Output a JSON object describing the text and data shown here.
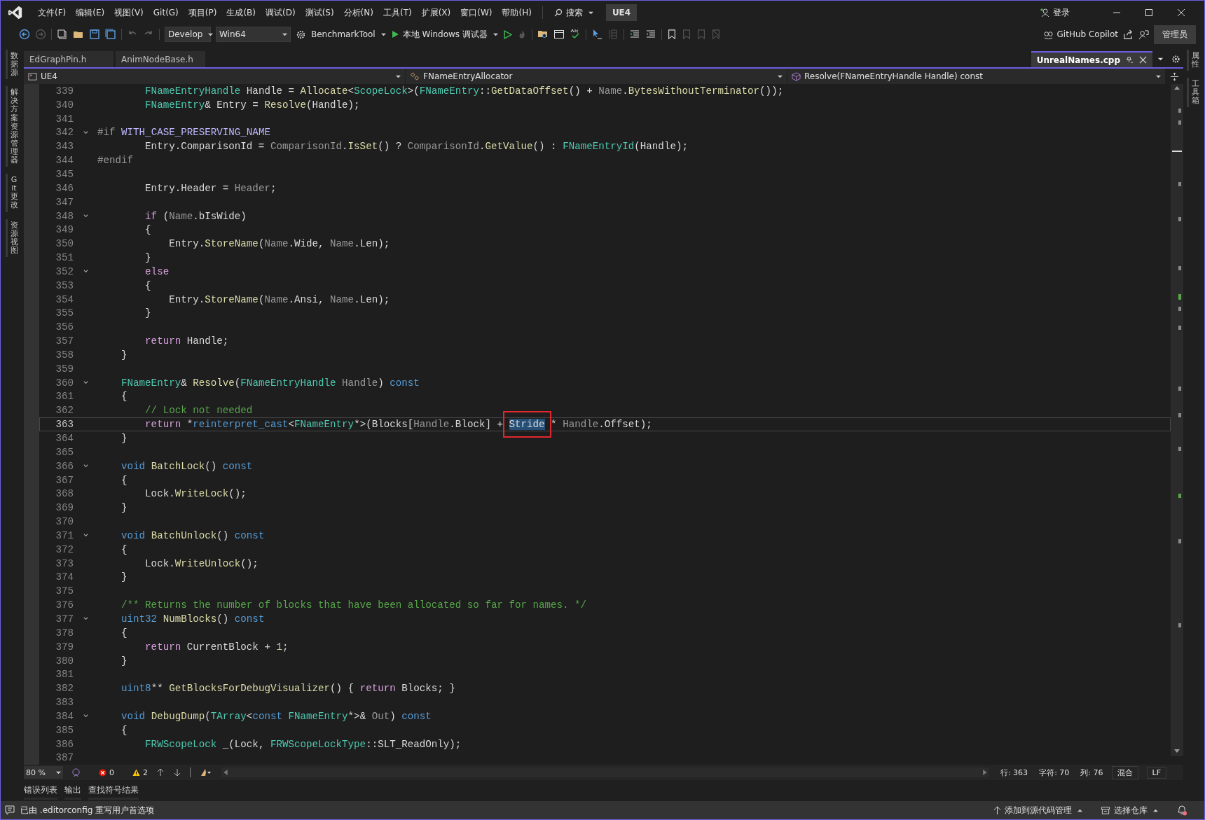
{
  "title_bar": {
    "menu": [
      "文件(F)",
      "编辑(E)",
      "视图(V)",
      "Git(G)",
      "项目(P)",
      "生成(B)",
      "调试(D)",
      "测试(S)",
      "分析(N)",
      "工具(T)",
      "扩展(X)",
      "窗口(W)",
      "帮助(H)"
    ],
    "search": "搜索",
    "solution": "UE4",
    "sign_in": "登录"
  },
  "toolbar": {
    "configuration": "Develop",
    "platform": "Win64",
    "startup_project": "BenchmarkTool",
    "debugger": "本地 Windows 调试器",
    "copilot": "GitHub Copilot",
    "admin": "管理员"
  },
  "left_panels": [
    "数据源",
    "解决方案资源管理器",
    "Git 更改",
    "资源视图"
  ],
  "right_panels": [
    "属性",
    "工具箱"
  ],
  "tabs": [
    {
      "label": "EdGraphPin.h",
      "selected": false
    },
    {
      "label": "AnimNodeBase.h",
      "selected": false
    },
    {
      "label": "UnrealNames.cpp",
      "selected": true
    }
  ],
  "navigation": {
    "project": "UE4",
    "scope": "FNameEntryAllocator",
    "member": "Resolve(FNameEntryHandle Handle) const"
  },
  "editor": {
    "lines": [
      {
        "number": "339",
        "fold": false,
        "current": false,
        "tokens": [
          {
            "text": "        FNameEntryHandle",
            "kind": "type"
          },
          {
            "text": " Handle = ",
            "kind": "plain"
          },
          {
            "text": "Allocate",
            "kind": "func"
          },
          {
            "text": "<",
            "kind": "plain"
          },
          {
            "text": "ScopeLock",
            "kind": "type"
          },
          {
            "text": ">(",
            "kind": "plain"
          },
          {
            "text": "FNameEntry",
            "kind": "type"
          },
          {
            "text": "::",
            "kind": "plain"
          },
          {
            "text": "GetDataOffset",
            "kind": "func"
          },
          {
            "text": "() + ",
            "kind": "plain"
          },
          {
            "text": "Name",
            "kind": "param"
          },
          {
            "text": ".",
            "kind": "plain"
          },
          {
            "text": "BytesWithoutTerminator",
            "kind": "func"
          },
          {
            "text": "());",
            "kind": "plain"
          }
        ]
      },
      {
        "number": "340",
        "fold": false,
        "current": false,
        "tokens": [
          {
            "text": "        FNameEntry",
            "kind": "type"
          },
          {
            "text": "& Entry = ",
            "kind": "plain"
          },
          {
            "text": "Resolve",
            "kind": "func"
          },
          {
            "text": "(Handle);",
            "kind": "plain"
          }
        ]
      },
      {
        "number": "341",
        "fold": false,
        "current": false
      },
      {
        "number": "342",
        "fold": true,
        "current": false,
        "tokens": [
          {
            "text": "#if ",
            "kind": "preproc"
          },
          {
            "text": "WITH_CASE_PRESERVING_NAME",
            "kind": "macro"
          }
        ]
      },
      {
        "number": "343",
        "fold": false,
        "current": false,
        "tokens": [
          {
            "text": "        Entry.ComparisonId = ",
            "kind": "plain"
          },
          {
            "text": "ComparisonId",
            "kind": "param"
          },
          {
            "text": ".",
            "kind": "plain"
          },
          {
            "text": "IsSet",
            "kind": "func"
          },
          {
            "text": "() ? ",
            "kind": "plain"
          },
          {
            "text": "ComparisonId",
            "kind": "param"
          },
          {
            "text": ".",
            "kind": "plain"
          },
          {
            "text": "GetValue",
            "kind": "func"
          },
          {
            "text": "() : ",
            "kind": "plain"
          },
          {
            "text": "FNameEntryId",
            "kind": "type"
          },
          {
            "text": "(Handle);",
            "kind": "plain"
          }
        ]
      },
      {
        "number": "344",
        "fold": false,
        "current": false,
        "tokens": [
          {
            "text": "#endif",
            "kind": "preproc"
          }
        ]
      },
      {
        "number": "345",
        "fold": false,
        "current": false
      },
      {
        "number": "346",
        "fold": false,
        "current": false,
        "tokens": [
          {
            "text": "        Entry.Header = ",
            "kind": "plain"
          },
          {
            "text": "Header",
            "kind": "param"
          },
          {
            "text": ";",
            "kind": "plain"
          }
        ]
      },
      {
        "number": "347",
        "fold": false,
        "current": false
      },
      {
        "number": "348",
        "fold": true,
        "current": false,
        "tokens": [
          {
            "text": "        if",
            "kind": "control"
          },
          {
            "text": " (",
            "kind": "plain"
          },
          {
            "text": "Name",
            "kind": "param"
          },
          {
            "text": ".bIsWide)",
            "kind": "plain"
          }
        ]
      },
      {
        "number": "349",
        "fold": false,
        "current": false,
        "tokens": [
          {
            "text": "        {",
            "kind": "plain"
          }
        ]
      },
      {
        "number": "350",
        "fold": false,
        "current": false,
        "tokens": [
          {
            "text": "            Entry.",
            "kind": "plain"
          },
          {
            "text": "StoreName",
            "kind": "func"
          },
          {
            "text": "(",
            "kind": "plain"
          },
          {
            "text": "Name",
            "kind": "param"
          },
          {
            "text": ".Wide, ",
            "kind": "plain"
          },
          {
            "text": "Name",
            "kind": "param"
          },
          {
            "text": ".Len);",
            "kind": "plain"
          }
        ]
      },
      {
        "number": "351",
        "fold": false,
        "current": false,
        "tokens": [
          {
            "text": "        }",
            "kind": "plain"
          }
        ]
      },
      {
        "number": "352",
        "fold": true,
        "current": false,
        "tokens": [
          {
            "text": "        else",
            "kind": "control"
          }
        ]
      },
      {
        "number": "353",
        "fold": false,
        "current": false,
        "tokens": [
          {
            "text": "        {",
            "kind": "plain"
          }
        ]
      },
      {
        "number": "354",
        "fold": false,
        "current": false,
        "tokens": [
          {
            "text": "            Entry.",
            "kind": "plain"
          },
          {
            "text": "StoreName",
            "kind": "func"
          },
          {
            "text": "(",
            "kind": "plain"
          },
          {
            "text": "Name",
            "kind": "param"
          },
          {
            "text": ".Ansi, ",
            "kind": "plain"
          },
          {
            "text": "Name",
            "kind": "param"
          },
          {
            "text": ".Len);",
            "kind": "plain"
          }
        ]
      },
      {
        "number": "355",
        "fold": false,
        "current": false,
        "tokens": [
          {
            "text": "        }",
            "kind": "plain"
          }
        ]
      },
      {
        "number": "356",
        "fold": false,
        "current": false
      },
      {
        "number": "357",
        "fold": false,
        "current": false,
        "tokens": [
          {
            "text": "        return",
            "kind": "control"
          },
          {
            "text": " Handle;",
            "kind": "plain"
          }
        ]
      },
      {
        "number": "358",
        "fold": false,
        "current": false,
        "tokens": [
          {
            "text": "    }",
            "kind": "plain"
          }
        ]
      },
      {
        "number": "359",
        "fold": false,
        "current": false
      },
      {
        "number": "360",
        "fold": true,
        "current": false,
        "tokens": [
          {
            "text": "    FNameEntry",
            "kind": "type"
          },
          {
            "text": "& ",
            "kind": "plain"
          },
          {
            "text": "Resolve",
            "kind": "func"
          },
          {
            "text": "(",
            "kind": "plain"
          },
          {
            "text": "FNameEntryHandle",
            "kind": "type"
          },
          {
            "text": " Handle",
            "kind": "param"
          },
          {
            "text": ") ",
            "kind": "plain"
          },
          {
            "text": "const",
            "kind": "keyword"
          }
        ]
      },
      {
        "number": "361",
        "fold": false,
        "current": false,
        "tokens": [
          {
            "text": "    {",
            "kind": "plain"
          }
        ]
      },
      {
        "number": "362",
        "fold": false,
        "current": false,
        "tokens": [
          {
            "text": "        // Lock not needed",
            "kind": "comment"
          }
        ]
      },
      {
        "number": "363",
        "fold": false,
        "current": true,
        "tokens": [
          {
            "text": "        return",
            "kind": "control"
          },
          {
            "text": " *",
            "kind": "plain"
          },
          {
            "text": "reinterpret_cast",
            "kind": "keyword"
          },
          {
            "text": "<",
            "kind": "plain"
          },
          {
            "text": "FNameEntry",
            "kind": "type"
          },
          {
            "text": "*>(Blocks[",
            "kind": "plain"
          },
          {
            "text": "Handle",
            "kind": "param"
          },
          {
            "text": ".Block] + ",
            "kind": "plain"
          },
          {
            "text": "Stride",
            "kind": "selected"
          },
          {
            "text": " * ",
            "kind": "plain"
          },
          {
            "text": "Handle",
            "kind": "param"
          },
          {
            "text": ".Offset);",
            "kind": "plain"
          }
        ]
      },
      {
        "number": "364",
        "fold": false,
        "current": false,
        "tokens": [
          {
            "text": "    }",
            "kind": "plain"
          }
        ]
      },
      {
        "number": "365",
        "fold": false,
        "current": false
      },
      {
        "number": "366",
        "fold": true,
        "current": false,
        "tokens": [
          {
            "text": "    void ",
            "kind": "keyword"
          },
          {
            "text": "BatchLock",
            "kind": "func"
          },
          {
            "text": "() ",
            "kind": "plain"
          },
          {
            "text": "const",
            "kind": "keyword"
          }
        ]
      },
      {
        "number": "367",
        "fold": false,
        "current": false,
        "tokens": [
          {
            "text": "    {",
            "kind": "plain"
          }
        ]
      },
      {
        "number": "368",
        "fold": false,
        "current": false,
        "tokens": [
          {
            "text": "        Lock.",
            "kind": "plain"
          },
          {
            "text": "WriteLock",
            "kind": "func"
          },
          {
            "text": "();",
            "kind": "plain"
          }
        ]
      },
      {
        "number": "369",
        "fold": false,
        "current": false,
        "tokens": [
          {
            "text": "    }",
            "kind": "plain"
          }
        ]
      },
      {
        "number": "370",
        "fold": false,
        "current": false
      },
      {
        "number": "371",
        "fold": true,
        "current": false,
        "tokens": [
          {
            "text": "    void ",
            "kind": "keyword"
          },
          {
            "text": "BatchUnlock",
            "kind": "func"
          },
          {
            "text": "() ",
            "kind": "plain"
          },
          {
            "text": "const",
            "kind": "keyword"
          }
        ]
      },
      {
        "number": "372",
        "fold": false,
        "current": false,
        "tokens": [
          {
            "text": "    {",
            "kind": "plain"
          }
        ]
      },
      {
        "number": "373",
        "fold": false,
        "current": false,
        "tokens": [
          {
            "text": "        Lock.",
            "kind": "plain"
          },
          {
            "text": "WriteUnlock",
            "kind": "func"
          },
          {
            "text": "();",
            "kind": "plain"
          }
        ]
      },
      {
        "number": "374",
        "fold": false,
        "current": false,
        "tokens": [
          {
            "text": "    }",
            "kind": "plain"
          }
        ]
      },
      {
        "number": "375",
        "fold": false,
        "current": false
      },
      {
        "number": "376",
        "fold": false,
        "current": false,
        "tokens": [
          {
            "text": "    /** Returns the number of blocks that have been allocated so far for names. */",
            "kind": "comment"
          }
        ]
      },
      {
        "number": "377",
        "fold": true,
        "current": false,
        "tokens": [
          {
            "text": "    uint32 ",
            "kind": "keyword"
          },
          {
            "text": "NumBlocks",
            "kind": "func"
          },
          {
            "text": "() ",
            "kind": "plain"
          },
          {
            "text": "const",
            "kind": "keyword"
          }
        ]
      },
      {
        "number": "378",
        "fold": false,
        "current": false,
        "tokens": [
          {
            "text": "    {",
            "kind": "plain"
          }
        ]
      },
      {
        "number": "379",
        "fold": false,
        "current": false,
        "tokens": [
          {
            "text": "        return",
            "kind": "control"
          },
          {
            "text": " CurrentBlock + ",
            "kind": "plain"
          },
          {
            "text": "1",
            "kind": "number"
          },
          {
            "text": ";",
            "kind": "plain"
          }
        ]
      },
      {
        "number": "380",
        "fold": false,
        "current": false,
        "tokens": [
          {
            "text": "    }",
            "kind": "plain"
          }
        ]
      },
      {
        "number": "381",
        "fold": false,
        "current": false
      },
      {
        "number": "382",
        "fold": false,
        "current": false,
        "tokens": [
          {
            "text": "    uint8",
            "kind": "keyword"
          },
          {
            "text": "** ",
            "kind": "plain"
          },
          {
            "text": "GetBlocksForDebugVisualizer",
            "kind": "func"
          },
          {
            "text": "() { ",
            "kind": "plain"
          },
          {
            "text": "return",
            "kind": "control"
          },
          {
            "text": " Blocks; }",
            "kind": "plain"
          }
        ]
      },
      {
        "number": "383",
        "fold": false,
        "current": false
      },
      {
        "number": "384",
        "fold": true,
        "current": false,
        "tokens": [
          {
            "text": "    void ",
            "kind": "keyword"
          },
          {
            "text": "DebugDump",
            "kind": "func"
          },
          {
            "text": "(",
            "kind": "plain"
          },
          {
            "text": "TArray",
            "kind": "type"
          },
          {
            "text": "<",
            "kind": "plain"
          },
          {
            "text": "const ",
            "kind": "keyword"
          },
          {
            "text": "FNameEntry",
            "kind": "type"
          },
          {
            "text": "*>& ",
            "kind": "plain"
          },
          {
            "text": "Out",
            "kind": "param"
          },
          {
            "text": ") ",
            "kind": "plain"
          },
          {
            "text": "const",
            "kind": "keyword"
          }
        ]
      },
      {
        "number": "385",
        "fold": false,
        "current": false,
        "tokens": [
          {
            "text": "    {",
            "kind": "plain"
          }
        ]
      },
      {
        "number": "386",
        "fold": false,
        "current": false,
        "tokens": [
          {
            "text": "        FRWScopeLock",
            "kind": "type"
          },
          {
            "text": " _(Lock, ",
            "kind": "plain"
          },
          {
            "text": "FRWScopeLockType",
            "kind": "type"
          },
          {
            "text": "::SLT_ReadOnly);",
            "kind": "plain"
          }
        ]
      },
      {
        "number": "387",
        "fold": false,
        "current": false
      }
    ]
  },
  "editor_status": {
    "zoom": "80 %",
    "errors": "0",
    "warnings": "2",
    "line": "行: 363",
    "character": "字符: 70",
    "column": "列: 76",
    "whitespace": "混合",
    "line_ending": "LF"
  },
  "tool_tabs": [
    "错误列表",
    "输出",
    "查找符号结果"
  ],
  "status_bar": {
    "message": "已由 .editorconfig 重写用户首选项",
    "source_control": "添加到源代码管理",
    "repository": "选择仓库"
  }
}
